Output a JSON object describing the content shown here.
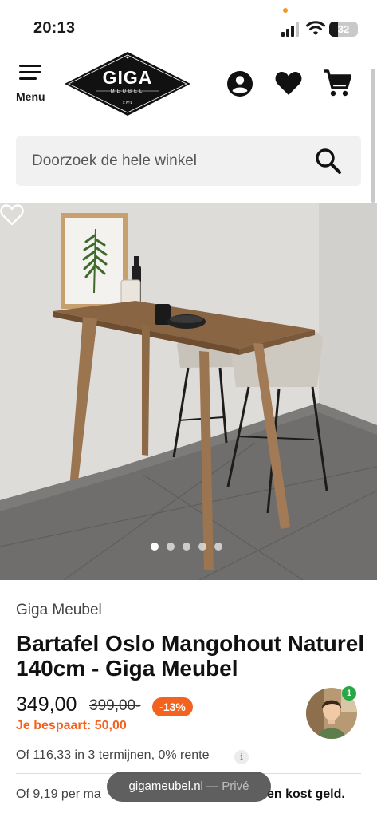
{
  "status_bar": {
    "time": "20:13",
    "battery": "32",
    "icons": [
      "signal-icon",
      "wifi-icon",
      "battery-icon"
    ]
  },
  "header": {
    "menu_label": "Menu",
    "logo": {
      "title": "GIGA",
      "subtitle": "MEUBEL",
      "mark": "x Nº1"
    },
    "icons": [
      "hamburger-icon",
      "account-icon",
      "heart-icon",
      "cart-icon"
    ]
  },
  "search": {
    "placeholder": "Doorzoek de hele winkel",
    "icon": "search-icon"
  },
  "gallery": {
    "slide_count": 5,
    "active_slide": 1,
    "wishlist_icon": "heart-outline-icon"
  },
  "product": {
    "brand": "Giga Meubel",
    "title": "Bartafel Oslo Mangohout Naturel 140cm - Giga Meubel",
    "price": "349,00",
    "old_price": "399,00-",
    "discount": "-13%",
    "savings": "Je bespaart: 50,00",
    "installments": "Of 116,33 in 3 termijnen, 0% rente",
    "pay_later_start": "Of 9,19 per ma",
    "pay_later_end": "en kost geld."
  },
  "chat": {
    "badge_count": "1"
  },
  "browser": {
    "domain": "gigameubel.nl",
    "mode": " — Privé"
  },
  "colors": {
    "accent_orange": "#f4621f",
    "badge_green": "#28a745",
    "text_dark": "#111111",
    "search_bg": "#f1f1f2"
  }
}
